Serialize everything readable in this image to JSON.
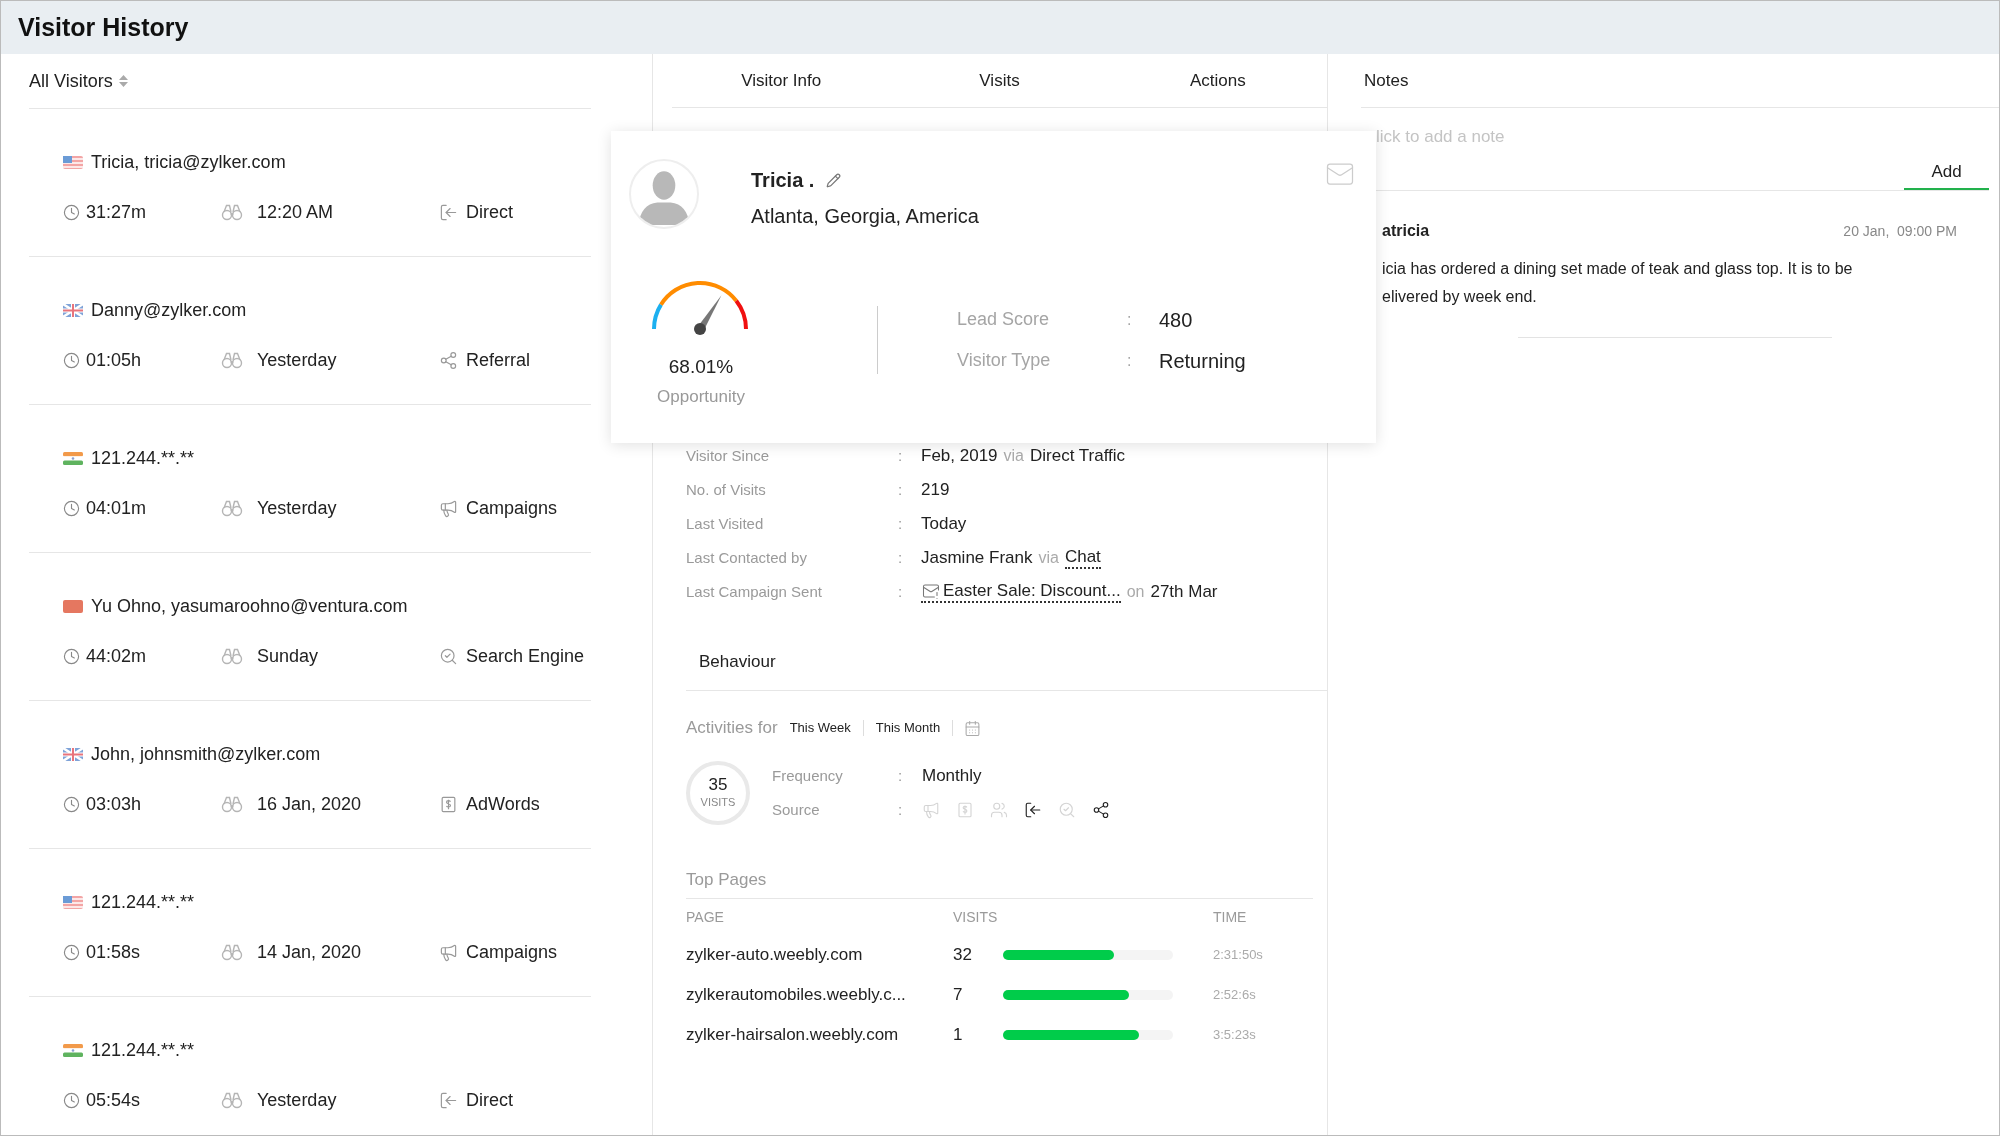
{
  "title": "Visitor History",
  "visitor_list": {
    "filter": "All Visitors",
    "visitors": [
      {
        "flag": {
          "kind": "us"
        },
        "name": "Tricia, tricia@zylker.com",
        "duration": "31:27m",
        "last_seen": "12:20 AM",
        "source": {
          "kind": "direct",
          "label": "Direct"
        }
      },
      {
        "flag": {
          "kind": "gb"
        },
        "name": "Danny@zylker.com",
        "duration": "01:05h",
        "last_seen": "Yesterday",
        "source": {
          "kind": "referral",
          "label": "Referral"
        }
      },
      {
        "flag": {
          "kind": "in"
        },
        "name": "121.244.**.**",
        "duration": "04:01m",
        "last_seen": "Yesterday",
        "source": {
          "kind": "campaign",
          "label": "Campaigns"
        }
      },
      {
        "flag": {
          "kind": "cn"
        },
        "name": "Yu Ohno, yasumaroohno@ventura.com",
        "duration": "44:02m",
        "last_seen": "Sunday",
        "source": {
          "kind": "search",
          "label": "Search Engine"
        }
      },
      {
        "flag": {
          "kind": "gb"
        },
        "name": "John, johnsmith@zylker.com",
        "duration": "03:03h",
        "last_seen": "16 Jan, 2020",
        "source": {
          "kind": "adwords",
          "label": "AdWords"
        }
      },
      {
        "flag": {
          "kind": "us"
        },
        "name": "121.244.**.**",
        "duration": "01:58s",
        "last_seen": "14 Jan, 2020",
        "source": {
          "kind": "campaign",
          "label": "Campaigns"
        }
      },
      {
        "flag": {
          "kind": "in"
        },
        "name": "121.244.**.**",
        "duration": "05:54s",
        "last_seen": "Yesterday",
        "source": {
          "kind": "direct",
          "label": "Direct"
        }
      }
    ]
  },
  "detail": {
    "tabs": [
      "Visitor Info",
      "Visits",
      "Actions"
    ],
    "info_rows": [
      {
        "label": "Visitor Since",
        "colon": ":",
        "parts": [
          {
            "text": "Feb, 2019",
            "kind": "value"
          },
          {
            "text": "via",
            "kind": "muted"
          },
          {
            "text": "Direct Traffic",
            "kind": "value"
          }
        ]
      },
      {
        "label": "No. of Visits",
        "colon": ":",
        "parts": [
          {
            "text": "219",
            "kind": "value"
          }
        ]
      },
      {
        "label": "Last Visited",
        "colon": ":",
        "parts": [
          {
            "text": "Today",
            "kind": "value"
          }
        ]
      },
      {
        "label": "Last Contacted by",
        "colon": ":",
        "parts": [
          {
            "text": "Jasmine Frank",
            "kind": "value"
          },
          {
            "text": "via",
            "kind": "muted"
          },
          {
            "text": "Chat",
            "kind": "link"
          }
        ]
      },
      {
        "label": "Last Campaign Sent",
        "colon": ":",
        "parts": [
          {
            "text": "Easter Sale: Discount...",
            "kind": "campaign"
          },
          {
            "text": "on",
            "kind": "muted"
          },
          {
            "text": "27th Mar",
            "kind": "value"
          }
        ]
      }
    ],
    "behaviour": {
      "title": "Behaviour",
      "activities_label": "Activities for",
      "periods": [
        "This Week",
        "This Month"
      ],
      "visits_count": "35",
      "visits_label": "VISITS",
      "frequency": {
        "label": "Frequency",
        "colon": ":",
        "value": "Monthly"
      },
      "source": {
        "label": "Source",
        "colon": ":",
        "icons": [
          {
            "kind": "campaign",
            "active": false
          },
          {
            "kind": "adwords",
            "active": false
          },
          {
            "kind": "people",
            "active": false
          },
          {
            "kind": "direct",
            "active": true
          },
          {
            "kind": "search",
            "active": false
          },
          {
            "kind": "referral",
            "active": true
          }
        ]
      }
    },
    "top_pages": {
      "title": "Top Pages",
      "columns": [
        "PAGE",
        "VISITS",
        "TIME"
      ],
      "rows": [
        {
          "page": "zylker-auto.weebly.com",
          "visits": "32",
          "level": 0.65,
          "time": "2:31:50s"
        },
        {
          "page": "zylkerautomobiles.weebly.c...",
          "visits": "7",
          "level": 0.74,
          "time": "2:52:6s"
        },
        {
          "page": "zylker-hairsalon.weebly.com",
          "visits": "1",
          "level": 0.8,
          "time": "3:5:23s"
        }
      ]
    }
  },
  "notes": {
    "title": "Notes",
    "placeholder": "lick to add a note",
    "add_button": "Add",
    "note": {
      "author": "atricia",
      "date": "20 Jan,  09:00 PM",
      "lines": [
        "icia has ordered a dining set made of teak and glass top. It is to be",
        "elivered by week end."
      ]
    }
  },
  "visitor_card": {
    "name": "Tricia .",
    "location": "Atlanta, Georgia, America",
    "gauge": {
      "level": 0.6801,
      "reading": "68.01%",
      "label": "Opportunity"
    },
    "stats": [
      {
        "label": "Lead Score",
        "colon": ":",
        "value": "480"
      },
      {
        "label": "Visitor Type",
        "colon": ":",
        "value": "Returning"
      }
    ]
  }
}
